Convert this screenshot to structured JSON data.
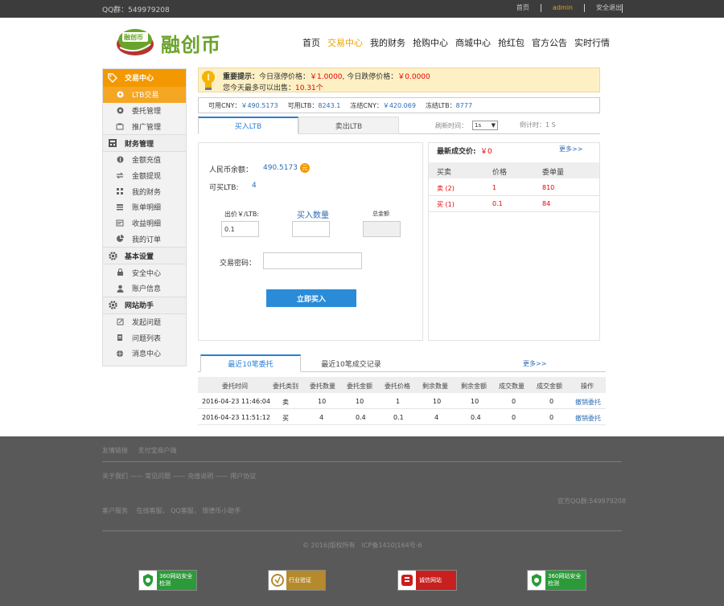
{
  "topbar": {
    "qq": "QQ群：549979208",
    "links": [
      "首页",
      "admin",
      "安全退出"
    ]
  },
  "header": {
    "brand": "融创币",
    "badge_text": "融创币",
    "nav": [
      "首页",
      "交易中心",
      "我的财务",
      "抢购中心",
      "商城中心",
      "抢红包",
      "官方公告",
      "实时行情"
    ],
    "active_nav": "交易中心"
  },
  "sidebar": {
    "sections": [
      {
        "title": "交易中心",
        "items": [
          "LTB交易",
          "委托管理",
          "推广管理"
        ]
      },
      {
        "title": "财务管理",
        "items": [
          "金额充值",
          "金额提现",
          "我的财务",
          "账单明细",
          "收益明细",
          "我的订单"
        ]
      },
      {
        "title": "基本设置",
        "items": [
          "安全中心",
          "账户信息"
        ]
      },
      {
        "title": "网站助手",
        "items": [
          "发起问题",
          "问题列表",
          "消息中心"
        ]
      }
    ]
  },
  "notice": {
    "label": "重要提示：",
    "up_text": "今日涨停价格：",
    "up_price": "￥1.0000",
    "down_text": ", 今日跌停价格：",
    "down_price": "￥0.0000",
    "sell_text": "您今天最多可以出售：",
    "sell_amount": "10.31个"
  },
  "balances": {
    "cny_label": "可用CNY：",
    "cny": "￥490.5173",
    "ltb_label": "可用LTB：",
    "ltb": "8243.1",
    "frozen_cny_label": "冻结CNY：",
    "frozen_cny": "￥420.069",
    "frozen_ltb_label": "冻结LTB：",
    "frozen_ltb": "8777"
  },
  "trade_tabs": {
    "buy": "买入LTB",
    "sell": "卖出LTB"
  },
  "refresh": {
    "label": "刷新时间：",
    "value": "1s",
    "countdown": "倒计时：1 S"
  },
  "buy_form": {
    "cny_label": "人民币余额：",
    "cny_value": "490.5173",
    "coin_glyph": "元",
    "can_buy_label": "可买LTB:",
    "can_buy_value": "4",
    "price_label": "出价￥/LTB:",
    "qty_label": "买入数量",
    "total_label": "总金额",
    "price_value": "0.1",
    "qty_value": "",
    "pwd_label": "交易密码：",
    "submit": "立即买入"
  },
  "order_book": {
    "last_label": "最新成交价:",
    "last_price": "￥0",
    "more": "更多>>",
    "columns": [
      "买卖",
      "价格",
      "委单量"
    ],
    "rows": [
      {
        "side": "卖 (2)",
        "price": "1",
        "qty": "810"
      },
      {
        "side": "买 (1)",
        "price": "0.1",
        "qty": "84"
      }
    ]
  },
  "history_tabs": {
    "recent_orders": "最近10笔委托",
    "recent_trades": "最近10笔成交记录",
    "more": "更多>>"
  },
  "orders": {
    "columns": [
      "委托时间",
      "委托类别",
      "委托数量",
      "委托金额",
      "委托价格",
      "剩余数量",
      "剩余金额",
      "成交数量",
      "成交金额",
      "操作"
    ],
    "rows": [
      [
        "2016-04-23 11:46:04",
        "卖",
        "10",
        "10",
        "1",
        "10",
        "10",
        "0",
        "0",
        "撤销委托"
      ],
      [
        "2016-04-23 11:51:12",
        "买",
        "4",
        "0.4",
        "0.1",
        "4",
        "0.4",
        "0",
        "0",
        "撤销委托"
      ]
    ]
  },
  "footer": {
    "friend_links": [
      "友情链接",
      "支付宝商户端"
    ],
    "about": [
      "关于我们",
      "常见问题",
      "充值说明",
      "用户协议"
    ],
    "official_qq": "官方QQ群:549979208",
    "service": [
      "客户服务",
      "在线客服",
      "QQ客服",
      "银德币小助手"
    ],
    "copyright": "© 2016|版权所有　ICP备1410|164号-6",
    "badges": [
      "360网站安全检测",
      "行业验证",
      "诚信网站",
      "360网站安全检测"
    ]
  }
}
